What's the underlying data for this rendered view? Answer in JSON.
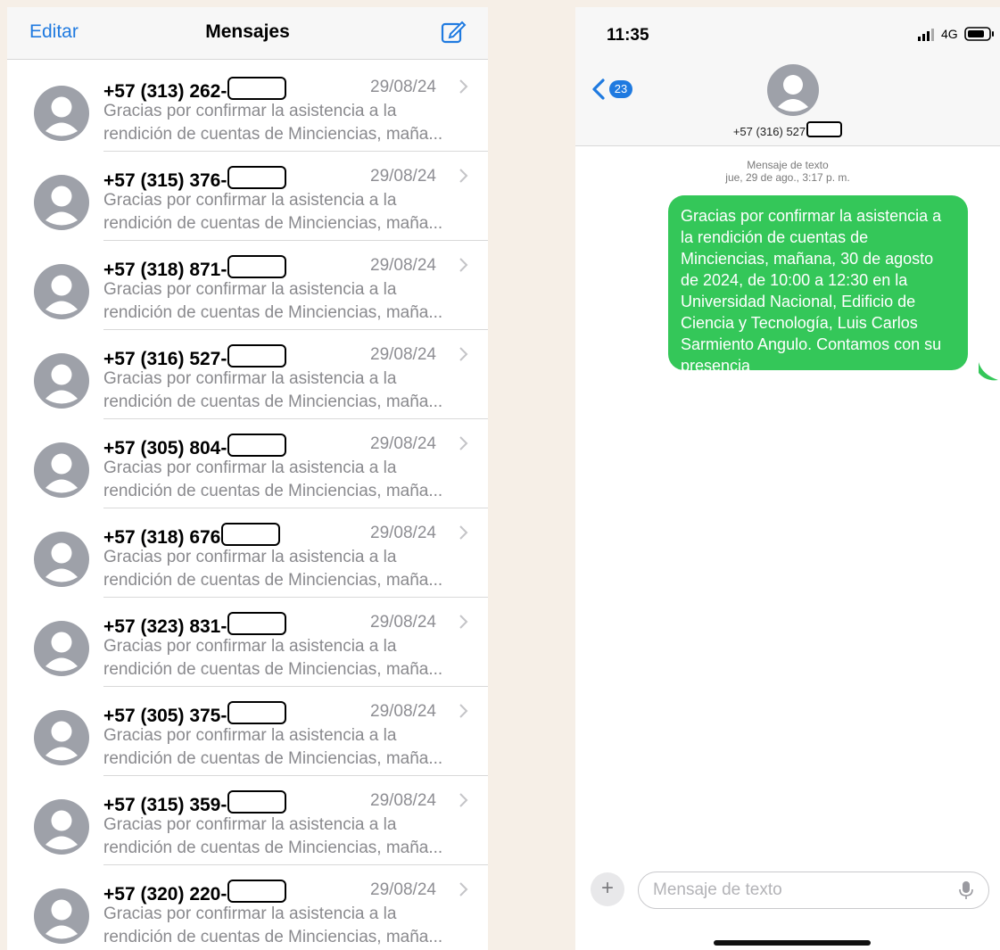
{
  "list": {
    "edit_label": "Editar",
    "title": "Mensajes",
    "compose_icon": "compose-icon",
    "rows": [
      {
        "sender": "+57 (313) 262-",
        "date": "29/08/24",
        "line1": "Gracias por confirmar la asistencia a la",
        "line2": "rendición de cuentas de Minciencias, maña..."
      },
      {
        "sender": "+57 (315) 376-",
        "date": "29/08/24",
        "line1": "Gracias por confirmar la asistencia a la",
        "line2": "rendición de cuentas de Minciencias, maña..."
      },
      {
        "sender": "+57 (318) 871-",
        "date": "29/08/24",
        "line1": "Gracias por confirmar la asistencia a la",
        "line2": "rendición de cuentas de Minciencias, maña..."
      },
      {
        "sender": "+57 (316) 527-",
        "date": "29/08/24",
        "line1": "Gracias por confirmar la asistencia a la",
        "line2": "rendición de cuentas de Minciencias, maña..."
      },
      {
        "sender": "+57 (305) 804-",
        "date": "29/08/24",
        "line1": "Gracias por confirmar la asistencia a la",
        "line2": "rendición de cuentas de Minciencias, maña..."
      },
      {
        "sender": "+57 (318) 676",
        "date": "29/08/24",
        "line1": "Gracias por confirmar la asistencia a la",
        "line2": "rendición de cuentas de Minciencias, maña..."
      },
      {
        "sender": "+57 (323) 831-",
        "date": "29/08/24",
        "line1": "Gracias por confirmar la asistencia a la",
        "line2": "rendición de cuentas de Minciencias, maña..."
      },
      {
        "sender": "+57 (305) 375-",
        "date": "29/08/24",
        "line1": "Gracias por confirmar la asistencia a la",
        "line2": "rendición de cuentas de Minciencias, maña..."
      },
      {
        "sender": "+57 (315) 359-",
        "date": "29/08/24",
        "line1": "Gracias por confirmar la asistencia a la",
        "line2": "rendición de cuentas de Minciencias, maña..."
      },
      {
        "sender": "+57 (320) 220-",
        "date": "29/08/24",
        "line1": "Gracias por confirmar la asistencia a la",
        "line2": "rendición de cuentas de Minciencias, maña..."
      }
    ]
  },
  "conversation": {
    "status_time": "11:35",
    "network": "4G",
    "back_badge": "23",
    "contact": "+57 (316) 527",
    "meta_type": "Mensaje de texto",
    "meta_time": "jue, 29 de ago., 3:17 p. m.",
    "message": "Gracias por confirmar la asistencia a la rendición de cuentas de Minciencias, mañana, 30 de agosto de 2024, de 10:00 a 12:30 en la Universidad Nacional, Edificio de Ciencia y Tecnología, Luis Carlos Sarmiento Angulo. Contamos con su presencia",
    "input_placeholder": "Mensaje de texto",
    "plus_label": "+",
    "bubble_color": "#34c759",
    "accent_color": "#1f7ae0"
  }
}
